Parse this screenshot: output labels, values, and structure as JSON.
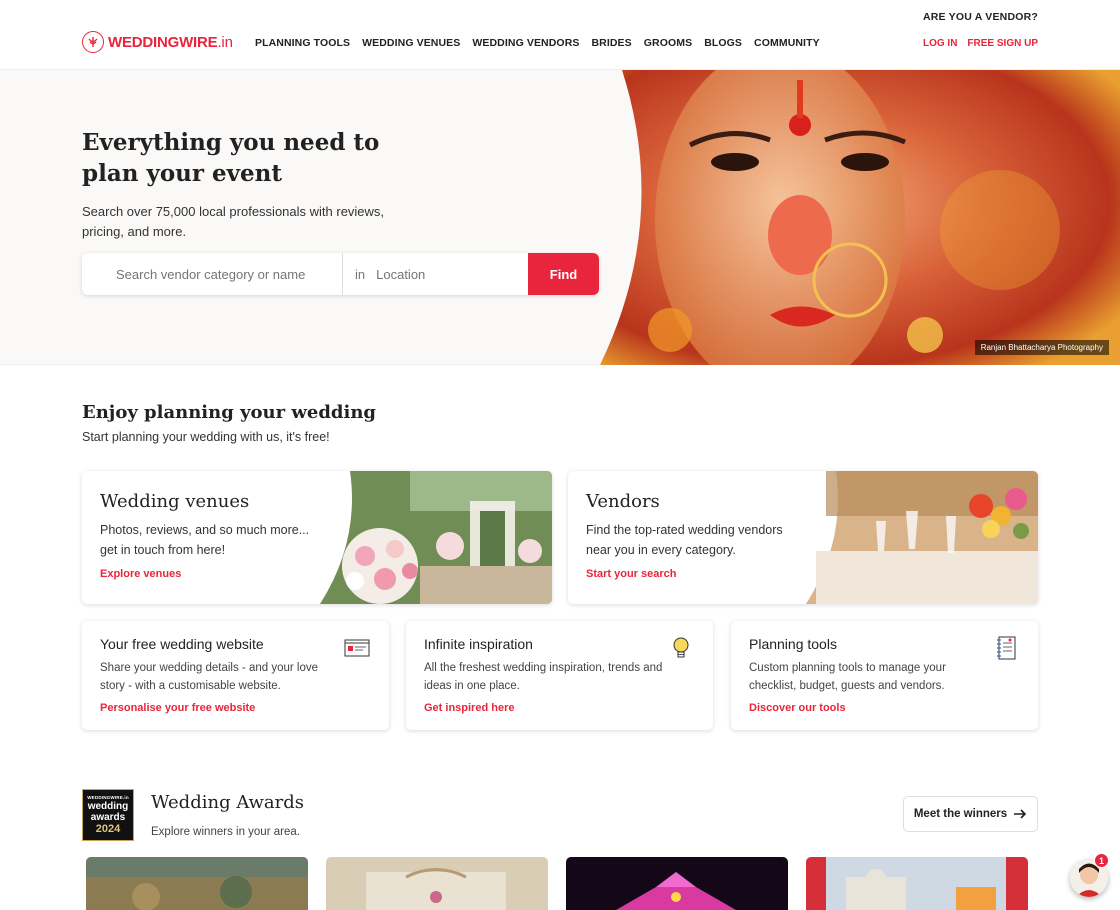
{
  "header": {
    "vendor_question": "ARE YOU A VENDOR?",
    "logo": {
      "brand": "WEDDINGWIRE",
      "suffix": ".in"
    },
    "nav": [
      "PLANNING TOOLS",
      "WEDDING VENUES",
      "WEDDING VENDORS",
      "BRIDES",
      "GROOMS",
      "BLOGS",
      "COMMUNITY"
    ],
    "login": "LOG IN",
    "signup": "FREE SIGN UP"
  },
  "hero": {
    "title": "Everything you need to plan your event",
    "subtitle": "Search over 75,000 local professionals with reviews, pricing, and more.",
    "search_placeholder": "Search vendor category or name",
    "in_label": "in",
    "location_placeholder": "Location",
    "find_label": "Find",
    "photo_credit": "Ranjan Bhattacharya Photography"
  },
  "planning": {
    "title": "Enjoy planning your wedding",
    "subtitle": "Start planning your wedding with us, it's free!",
    "big_cards": [
      {
        "title": "Wedding venues",
        "desc": "Photos, reviews, and so much more... get in touch from here!",
        "link": "Explore venues"
      },
      {
        "title": "Vendors",
        "desc": "Find the top-rated wedding vendors near you in every category.",
        "link": "Start your search"
      }
    ],
    "small_cards": [
      {
        "title": "Your free wedding website",
        "desc": "Share your wedding details - and your love story - with a customisable website.",
        "link": "Personalise your free website",
        "icon": "website-card-icon"
      },
      {
        "title": "Infinite inspiration",
        "desc": "All the freshest wedding inspiration, trends and ideas in one place.",
        "link": "Get inspired here",
        "icon": "lightbulb-icon"
      },
      {
        "title": "Planning tools",
        "desc": "Custom planning tools to manage your checklist, budget, guests and vendors.",
        "link": "Discover our tools",
        "icon": "notebook-icon"
      }
    ]
  },
  "awards": {
    "badge_brand": "WEDDINGWIRE.in",
    "badge_line1": "wedding",
    "badge_line2": "awards",
    "badge_year": "2024",
    "title": "Wedding Awards",
    "subtitle": "Explore winners in your area.",
    "winners_button": "Meet the winners"
  },
  "chat": {
    "badge_count": "1"
  },
  "colors": {
    "accent": "#e8253c",
    "text": "#222222",
    "hero_bg": "#faf9f8"
  }
}
